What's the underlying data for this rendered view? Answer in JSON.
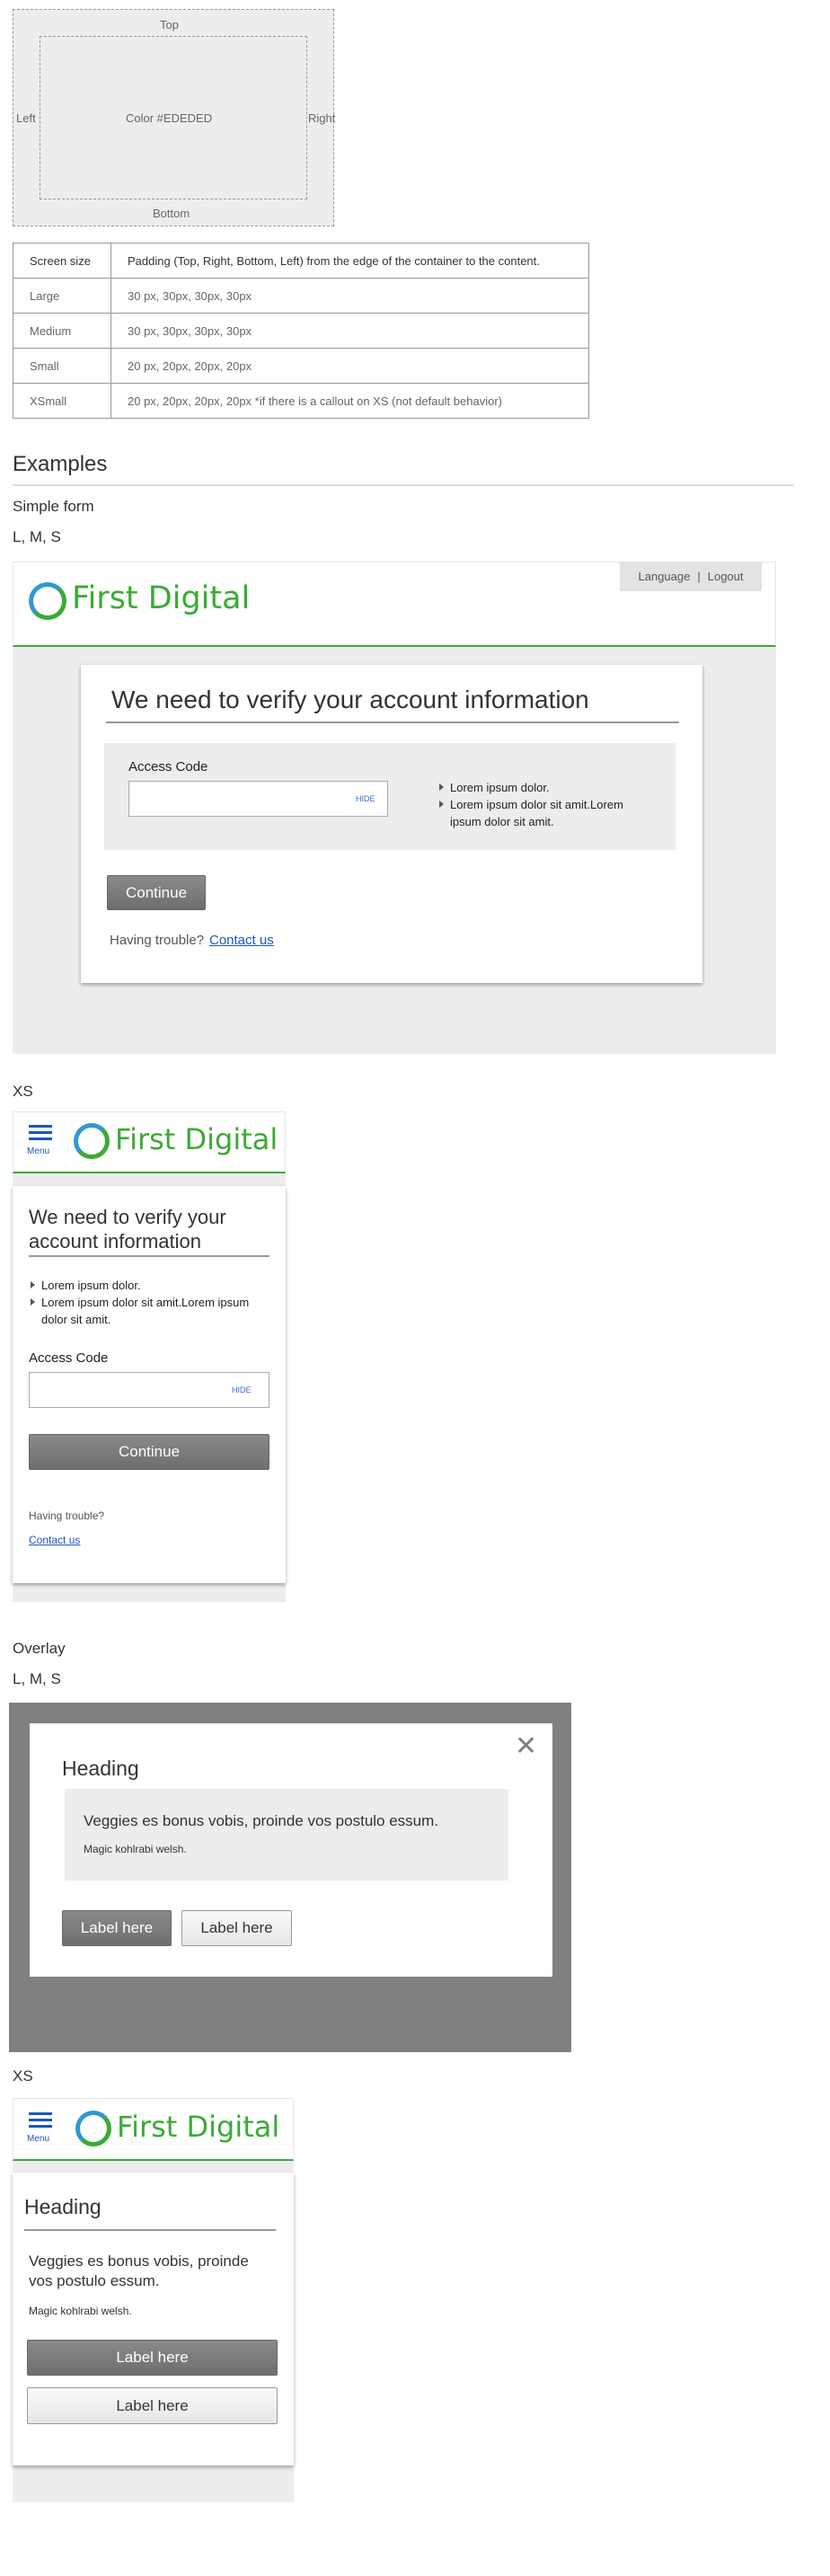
{
  "padding_diagram": {
    "top": "Top",
    "left": "Left",
    "right": "Right",
    "bottom": "Bottom",
    "center": "Color #EDEDED"
  },
  "padding_table": {
    "header": [
      "Screen size",
      "Padding (Top, Right, Bottom, Left) from the edge of the container to the content."
    ],
    "rows": [
      [
        "Large",
        "30 px, 30px, 30px, 30px"
      ],
      [
        "Medium",
        "30 px, 30px, 30px, 30px"
      ],
      [
        "Small",
        "20 px, 20px, 20px, 20px"
      ],
      [
        "XSmall",
        "20 px, 20px, 20px, 20px  *if there is a callout on XS (not default behavior)"
      ]
    ]
  },
  "sections": {
    "examples": "Examples",
    "simple_form": "Simple form",
    "lms_1": "L, M, S",
    "xs_1": "XS",
    "overlay": "Overlay",
    "lms_2": "L, M, S",
    "xs_2": "XS"
  },
  "brand": {
    "name": "First Digital",
    "green": "#3aab35",
    "blue": "#2e9ad0"
  },
  "header_links": {
    "language": "Language",
    "separator": "|",
    "logout": "Logout"
  },
  "form": {
    "title": "We need to verify your account information",
    "access_code_label": "Access Code",
    "access_code_value": "",
    "hide_label": "HIDE",
    "bullets": [
      "Lorem ipsum dolor.",
      "Lorem ipsum dolor sit amit.Lorem ipsum dolor sit amit."
    ],
    "continue": "Continue",
    "trouble": "Having trouble?",
    "contact": "Contact us"
  },
  "mobile": {
    "menu_label": "Menu",
    "title": "We need to verify your account information"
  },
  "overlay_card": {
    "close_icon": "close-icon",
    "close_glyph": "✕",
    "heading": "Heading",
    "body_large": "Veggies es bonus vobis, proinde vos postulo essum.",
    "body_small": "Magic kohlrabi welsh.",
    "primary": "Label here",
    "secondary": "Label here"
  }
}
